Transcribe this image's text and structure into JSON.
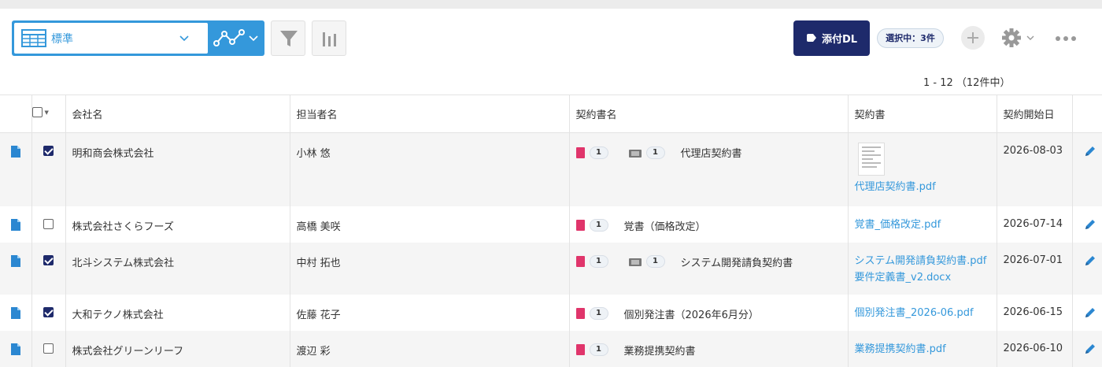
{
  "toolbar": {
    "view_name": "標準",
    "download_label": "添付DL",
    "selection_badge": "選択中：3件"
  },
  "pagination": {
    "range": "1 - 12 （12件中）"
  },
  "table": {
    "headers": [
      "会社名",
      "担当者名",
      "契約書名",
      "契約書",
      "契約開始日"
    ],
    "rows": [
      {
        "checked": true,
        "company": "明和商会株式会社",
        "person": "小林 悠",
        "contract_count": "1",
        "extra_count": "1",
        "contract_name": "代理店契約書",
        "files": [
          "代理店契約書.pdf"
        ],
        "start": "2026-08-03"
      },
      {
        "checked": false,
        "company": "株式会社さくらフーズ",
        "person": "高橋 美咲",
        "contract_count": "1",
        "extra_count": "",
        "contract_name": "覚書（価格改定）",
        "files": [
          "覚書_価格改定.pdf"
        ],
        "start": "2026-07-14"
      },
      {
        "checked": true,
        "company": "北斗システム株式会社",
        "person": "中村 拓也",
        "contract_count": "1",
        "extra_count": "1",
        "contract_name": "システム開発請負契約書",
        "files": [
          "システム開発請負契約書.pdf",
          "要件定義書_v2.docx"
        ],
        "start": "2026-07-01"
      },
      {
        "checked": true,
        "company": "大和テクノ株式会社",
        "person": "佐藤 花子",
        "contract_count": "1",
        "extra_count": "",
        "contract_name": "個別発注書（2026年6月分）",
        "files": [
          "個別発注書_2026-06.pdf"
        ],
        "start": "2026-06-15"
      },
      {
        "checked": false,
        "company": "株式会社グリーンリーフ",
        "person": "渡辺 彩",
        "contract_count": "1",
        "extra_count": "",
        "contract_name": "業務提携契約書",
        "files": [
          "業務提携契約書.pdf"
        ],
        "start": "2026-06-10"
      }
    ]
  },
  "colors": {
    "accent": "#3498db",
    "navy": "#1e2a6b",
    "book": "#e0356b"
  }
}
